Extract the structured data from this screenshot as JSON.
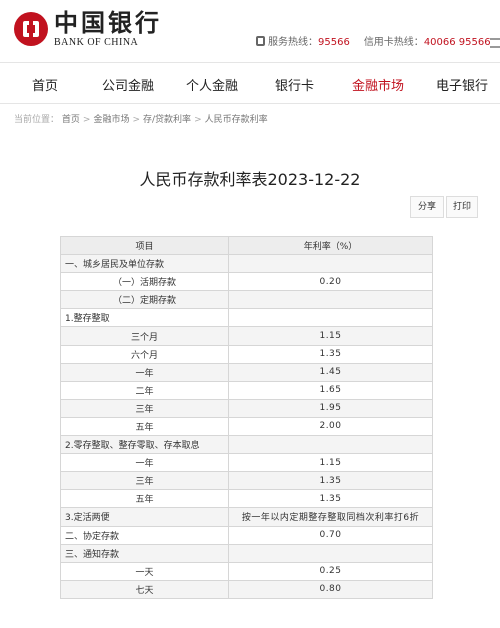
{
  "header": {
    "logo_cn": "中国银行",
    "logo_en": "BANK OF CHINA",
    "service_hotline_label": "服务热线：",
    "service_hotline": "95566",
    "card_hotline_label": "信用卡热线：",
    "card_hotline": "40066 95566"
  },
  "nav": {
    "items": [
      "首页",
      "公司金融",
      "个人金融",
      "银行卡",
      "金融市场",
      "电子银行"
    ],
    "active": "金融市场"
  },
  "breadcrumb": {
    "location_label": "当前位置：",
    "items": [
      "首页",
      "金融市场",
      "存/贷款利率",
      "人民币存款利率"
    ]
  },
  "page": {
    "title": "人民币存款利率表2023-12-22",
    "share_label": "分享",
    "print_label": "打印"
  },
  "table": {
    "headers": [
      "项目",
      "年利率（%）"
    ],
    "rows": [
      [
        "一、城乡居民及单位存款",
        ""
      ],
      [
        "（一）活期存款",
        "0.20"
      ],
      [
        "（二）定期存款",
        ""
      ],
      [
        "1.整存整取",
        ""
      ],
      [
        "三个月",
        "1.15"
      ],
      [
        "六个月",
        "1.35"
      ],
      [
        "一年",
        "1.45"
      ],
      [
        "二年",
        "1.65"
      ],
      [
        "三年",
        "1.95"
      ],
      [
        "五年",
        "2.00"
      ],
      [
        "2.零存整取、整存零取、存本取息",
        ""
      ],
      [
        "一年",
        "1.15"
      ],
      [
        "三年",
        "1.35"
      ],
      [
        "五年",
        "1.35"
      ],
      [
        "3.定活两便",
        "按一年以内定期整存整取同档次利率打6折"
      ],
      [
        "二、协定存款",
        "0.70"
      ],
      [
        "三、通知存款",
        ""
      ],
      [
        "一天",
        "0.25"
      ],
      [
        "七天",
        "0.80"
      ]
    ]
  },
  "colors": {
    "brand_red": "#c1121f",
    "header_row": "#ededed",
    "alt_row": "#f4f4f4"
  }
}
